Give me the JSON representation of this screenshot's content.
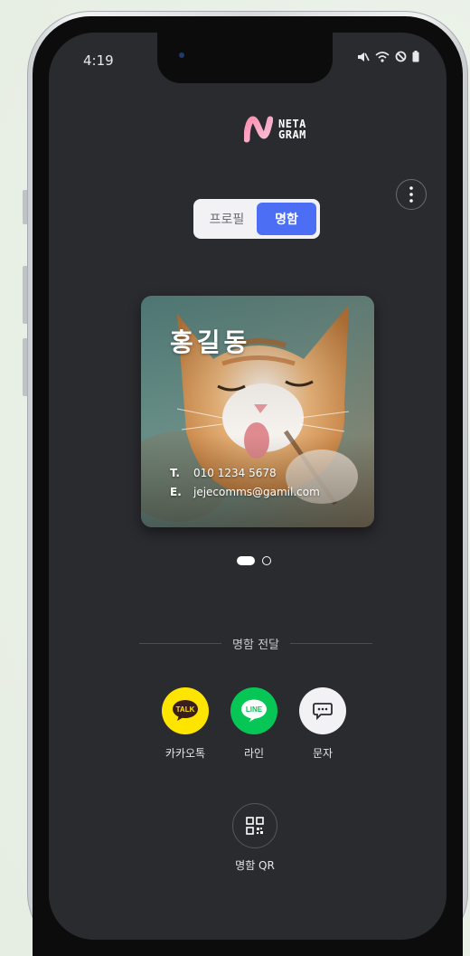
{
  "status_bar": {
    "time": "4:19",
    "icons": [
      "mute-icon",
      "wifi-icon",
      "do-not-disturb-icon",
      "battery-icon"
    ]
  },
  "logo": {
    "line1": "NETA",
    "line2": "GRAM",
    "icon": "neta-logo-icon"
  },
  "menu": {
    "icon": "more-vertical-icon"
  },
  "toggle": {
    "options": [
      "프로필",
      "명함"
    ],
    "selected": "명함",
    "accent": "#4c6ef5"
  },
  "card": {
    "name": "홍길동",
    "phone_key": "T.",
    "phone": "010 1234 5678",
    "email_key": "E.",
    "email": "jejecomms@gamil.com"
  },
  "pagination": {
    "total": 2,
    "current": 1
  },
  "share": {
    "title": "명함 전달",
    "items": [
      {
        "label": "카카오톡",
        "icon": "kakaotalk-icon",
        "badge": "TALK",
        "color": "#fee500"
      },
      {
        "label": "라인",
        "icon": "line-icon",
        "badge": "LINE",
        "color": "#06c755"
      },
      {
        "label": "문자",
        "icon": "sms-icon",
        "color": "#f2f2f4"
      }
    ],
    "qr_label": "명함 QR"
  },
  "colors": {
    "screen_bg": "#2a2b2f",
    "accent": "#4c6ef5"
  }
}
